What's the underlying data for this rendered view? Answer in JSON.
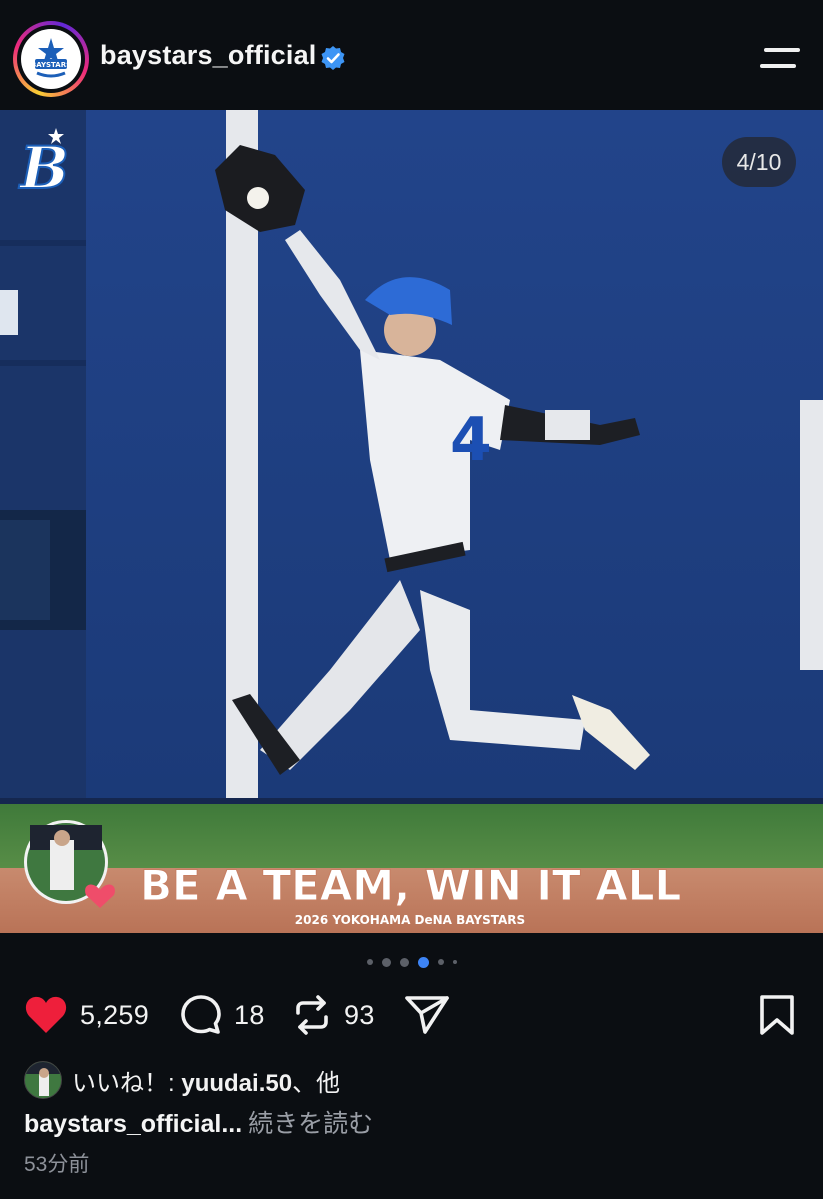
{
  "header": {
    "username": "baystars_official",
    "verified_icon": "verified-badge-icon",
    "menu_icon": "hamburger-menu-icon",
    "avatar_icon": "baystars-logo"
  },
  "post": {
    "counter": "4/10",
    "banner_text": "BE A TEAM, WIN IT ALL",
    "banner_sub": "2026 YOKOHAMA DeNA BAYSTARS",
    "team_logo": "B",
    "jersey_number": "4",
    "accent_color": "#3d84f6"
  },
  "carousel": {
    "total_dots": 6,
    "active_index": 3
  },
  "actions": {
    "likes": "5,259",
    "comments": "18",
    "reposts": "93"
  },
  "likes_line": {
    "prefix": "いいね！: ",
    "user": "yuudai.50",
    "suffix": "、他"
  },
  "caption": {
    "user": "baystars_official...",
    "more": "続きを読む"
  },
  "timestamp": "53分前"
}
